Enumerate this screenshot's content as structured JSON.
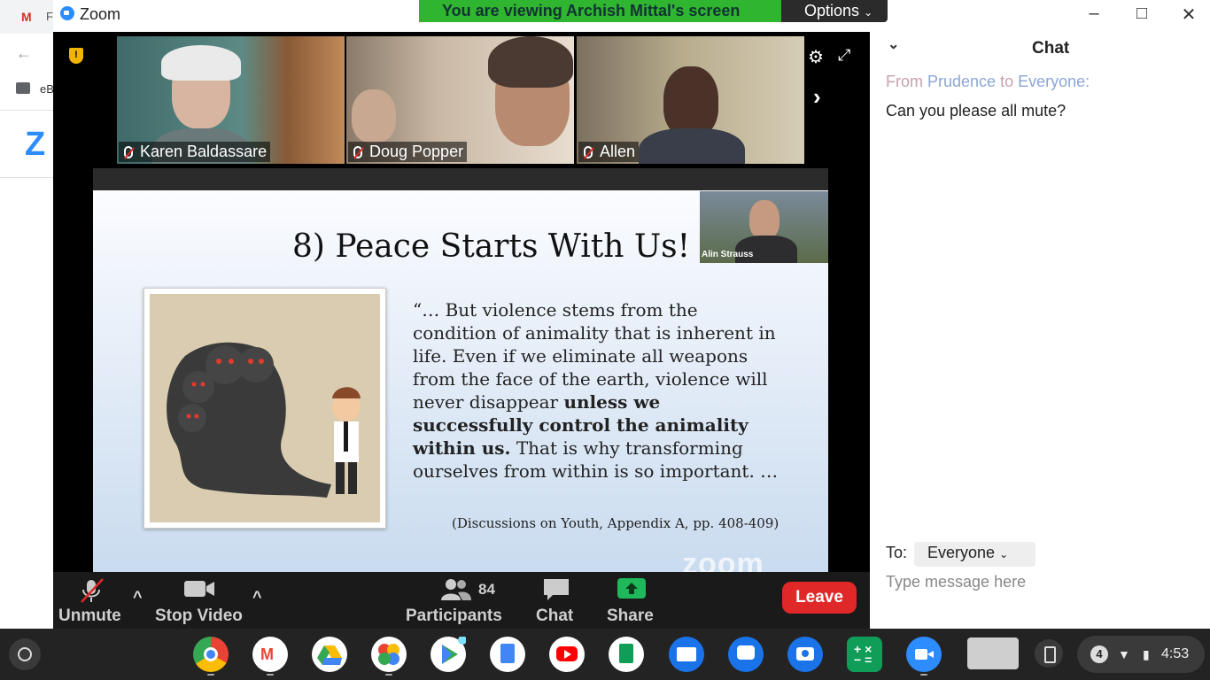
{
  "background_browser": {
    "tab_letter": "F",
    "bookmark_label": "eB",
    "logo_letter": "Z"
  },
  "window": {
    "app_title": "Zoom",
    "share_banner": "You are viewing Archish Mittal's screen",
    "options_label": "Options",
    "minimize": "–",
    "maximize": "□",
    "close": "✕"
  },
  "participants_strip": [
    {
      "name": "Karen Baldassare",
      "muted": true
    },
    {
      "name": "Doug Popper",
      "muted": true
    },
    {
      "name": "Allen",
      "muted": true
    }
  ],
  "slide": {
    "title": "8) Peace Starts With Us!",
    "quote_start": "“… But violence stems from the condition of animality that is inherent in life. Even if we eliminate all weapons from the face of the earth, violence will never disappear ",
    "quote_bold": "unless we successfully control the animality within us.",
    "quote_end": " That is why transforming ourselves from within is so important. …",
    "citation": "(Discussions on Youth, Appendix A, pp. 408-409)",
    "presenter_name": "Alin Strauss",
    "watermark": "zoom"
  },
  "toolbar": {
    "unmute": "Unmute",
    "stop_video": "Stop Video",
    "participants": "Participants",
    "participants_count": "84",
    "chat": "Chat",
    "share": "Share",
    "leave": "Leave"
  },
  "chat": {
    "title": "Chat",
    "from_prefix": "From",
    "from_name": "Prudence",
    "to_word": "to",
    "to_name": "Everyone:",
    "message": "Can you please all mute?",
    "to_label": "To:",
    "recipient": "Everyone",
    "input_placeholder": "Type message here"
  },
  "shelf": {
    "notification_count": "4",
    "time": "4:53",
    "apps": [
      "chrome-icon",
      "gmail-icon",
      "drive-icon",
      "photos-icon",
      "play-store-icon",
      "docs-icon",
      "youtube-icon",
      "sheets-icon",
      "files-icon",
      "messages-icon",
      "camera-icon",
      "calculator-icon",
      "zoom-icon"
    ]
  },
  "colors": {
    "share_banner": "#2fb52f",
    "leave": "#e02828",
    "zoom_blue": "#2d8cff"
  }
}
